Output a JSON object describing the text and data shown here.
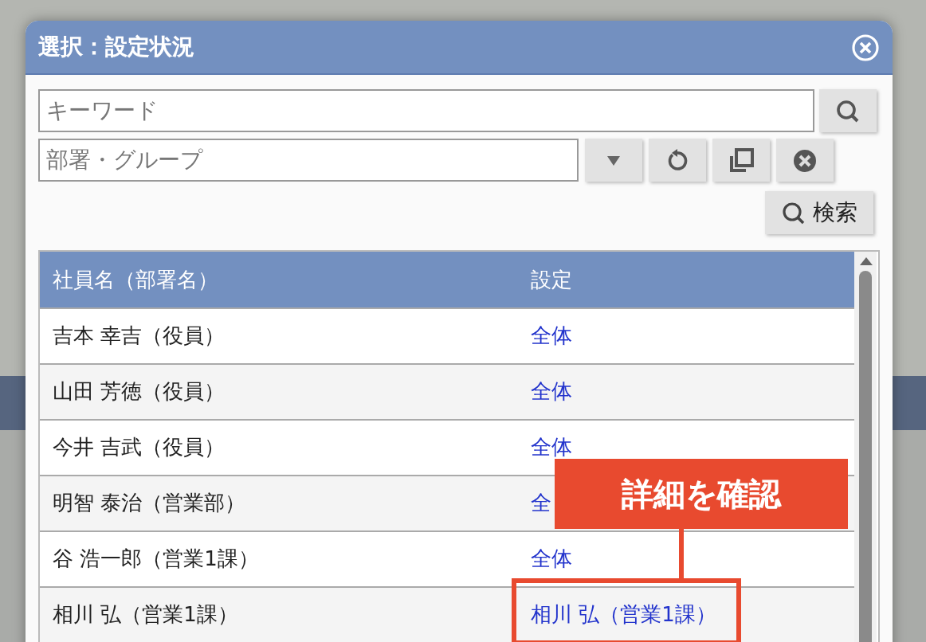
{
  "dialog": {
    "title": "選択：設定状況"
  },
  "keyword": {
    "placeholder": "キーワード"
  },
  "group": {
    "placeholder": "部署・グループ"
  },
  "search_button": "検索",
  "table": {
    "columns": [
      "社員名（部署名）",
      "設定"
    ],
    "rows": [
      {
        "name": "吉本 幸吉（役員）",
        "setting": "全体"
      },
      {
        "name": "山田 芳徳（役員）",
        "setting": "全体"
      },
      {
        "name": "今井 吉武（役員）",
        "setting": "全体"
      },
      {
        "name": "明智 泰治（営業部）",
        "setting": "全"
      },
      {
        "name": "谷 浩一郎（営業1課）",
        "setting": "全体"
      },
      {
        "name": "相川 弘（営業1課）",
        "setting": "相川 弘（営業1課）"
      }
    ]
  },
  "callout": {
    "text": "詳細を確認"
  }
}
